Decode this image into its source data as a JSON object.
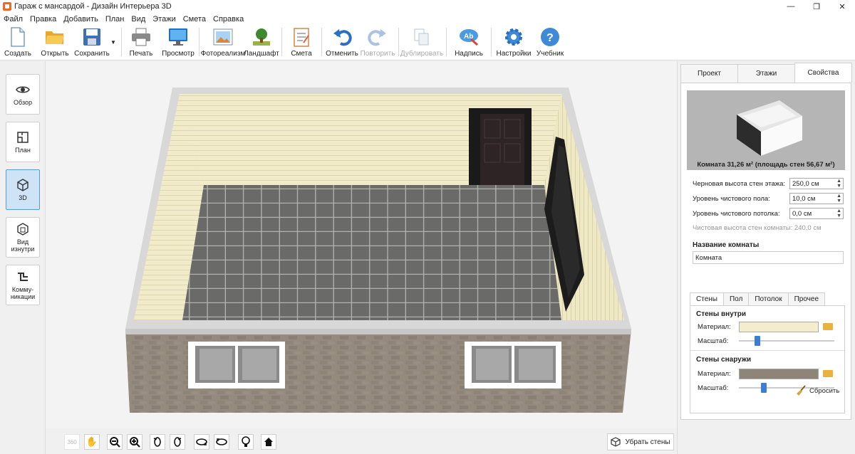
{
  "window": {
    "title": "Гараж с мансардой - Дизайн Интерьера 3D",
    "minimize": "—",
    "restore": "❐",
    "close": "✕"
  },
  "menu": [
    "Файл",
    "Правка",
    "Добавить",
    "План",
    "Вид",
    "Этажи",
    "Смета",
    "Справка"
  ],
  "toolbar": {
    "create": "Создать",
    "open": "Открыть",
    "save": "Сохранить",
    "print": "Печать",
    "preview": "Просмотр",
    "photorealism": "Фотореализм",
    "landscape": "Ландшафт",
    "estimate": "Смета",
    "undo": "Отменить",
    "redo": "Повторить",
    "duplicate": "Дублировать",
    "label": "Надпись",
    "settings": "Настройки",
    "tutorial": "Учебник"
  },
  "leftbar": {
    "overview": "Обзор",
    "plan": "План",
    "view3d": "3D",
    "inside_view": "Вид изнутри",
    "communications": "Комму-никации"
  },
  "bottombar": {
    "remove_walls": "Убрать стены"
  },
  "rightpanel": {
    "tabs": [
      "Проект",
      "Этажи",
      "Свойства"
    ],
    "room_caption": "Комната 31,26 м²  (площадь стен 56,67 м²)",
    "rough_height_label": "Черновая высота стен этажа:",
    "rough_height_value": "250,0 см",
    "floor_level_label": "Уровень чистового пола:",
    "floor_level_value": "10,0 см",
    "ceiling_level_label": "Уровень чистового потолка:",
    "ceiling_level_value": "0,0 см",
    "clean_height_text": "Чистовая высота стен комнаты: 240,0 см",
    "room_name_title": "Название комнаты",
    "room_name_value": "Комната",
    "subtabs": [
      "Стены",
      "Пол",
      "Потолок",
      "Прочее"
    ],
    "inner_walls_title": "Стены внутри",
    "outer_walls_title": "Стены снаружи",
    "material_label": "Материал:",
    "scale_label": "Масштаб:",
    "reset": "Сбросить",
    "colors": {
      "inner_material": "#f3edcd",
      "outer_material": "#8f8478",
      "accent": "#3a7fd5"
    }
  }
}
